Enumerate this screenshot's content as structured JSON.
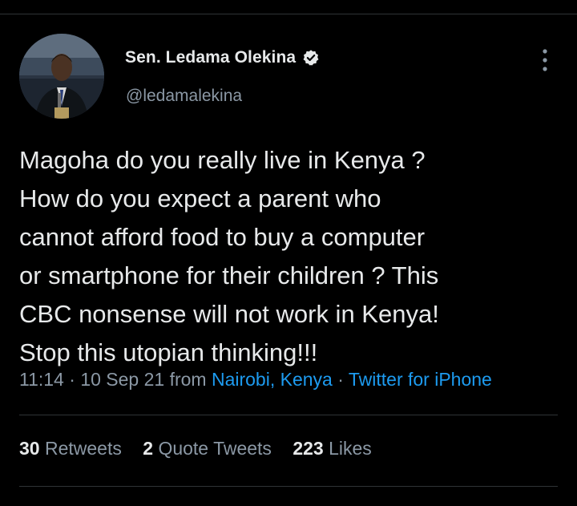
{
  "tweet": {
    "author": {
      "display_name": "Sen. Ledama Olekina",
      "handle": "@ledamalekina",
      "verified": true
    },
    "text_lines": [
      "Magoha do you really live in Kenya ?",
      "How do you expect a parent who",
      "cannot afford food to buy a computer",
      "or smartphone for their children ? This",
      "CBC nonsense will not work in Kenya!",
      "Stop this utopian thinking!!!"
    ],
    "meta": {
      "time": "11:14",
      "date": "10 Sep 21",
      "from_word": "from",
      "location": "Nairobi, Kenya",
      "source": "Twitter for iPhone",
      "sep": "·"
    },
    "stats": [
      {
        "count": "30",
        "label": "Retweets"
      },
      {
        "count": "2",
        "label": "Quote Tweets"
      },
      {
        "count": "223",
        "label": "Likes"
      }
    ]
  },
  "icons": {
    "verified": "verified-badge-icon",
    "more": "more-vertical-icon"
  },
  "colors": {
    "background": "#000000",
    "text_primary": "#e7e9ea",
    "text_secondary": "#8b98a5",
    "link": "#1d9bf0",
    "divider": "#2f3336"
  }
}
